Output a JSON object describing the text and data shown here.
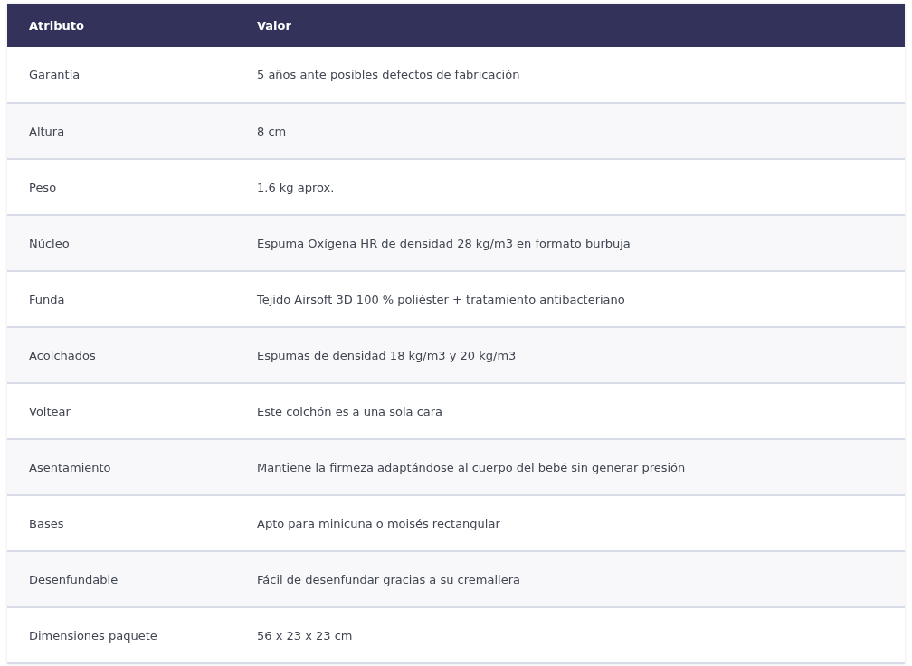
{
  "table": {
    "columns": [
      "Atributo",
      "Valor"
    ],
    "rows": [
      [
        "Garantía",
        "5 años ante posibles defectos de fabricación"
      ],
      [
        "Altura",
        "8 cm"
      ],
      [
        "Peso",
        "1.6 kg aprox."
      ],
      [
        "Núcleo",
        "Espuma Oxígena HR de densidad 28 kg/m3 en formato burbuja"
      ],
      [
        "Funda",
        "Tejido Airsoft 3D 100 % poliéster + tratamiento antibacteriano"
      ],
      [
        "Acolchados",
        "Espumas de densidad 18 kg/m3 y 20 kg/m3"
      ],
      [
        "Voltear",
        "Este colchón es a una sola cara"
      ],
      [
        "Asentamiento",
        "Mantiene la firmeza adaptándose al cuerpo del bebé sin generar presión"
      ],
      [
        "Bases",
        "Apto para minicuna o moisés rectangular"
      ],
      [
        "Desenfundable",
        "Fácil de desenfundar gracias a su cremallera"
      ],
      [
        "Dimensiones paquete",
        "56 x 23 x 23 cm"
      ]
    ]
  }
}
